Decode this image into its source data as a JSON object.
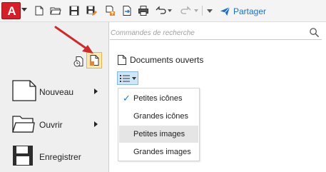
{
  "app": {
    "logo_letter": "A",
    "logo_color": "#d5202a"
  },
  "toolbar": {
    "icons": [
      "new-file-icon",
      "open-folder-icon",
      "save-icon",
      "save-as-icon",
      "save-to-web-icon",
      "open-from-web-icon",
      "print-icon",
      "undo-icon",
      "redo-icon",
      "customize-toolbar-icon"
    ],
    "share_label": "Partager",
    "accent": "#1f6fbf"
  },
  "search": {
    "placeholder": "Commandes de recherche"
  },
  "panel": {
    "title": "Documents ouverts",
    "view_menu": {
      "items": [
        {
          "label": "Petites icônes",
          "checked": true
        },
        {
          "label": "Grandes icônes",
          "checked": false
        },
        {
          "label": "Petites images",
          "checked": false
        },
        {
          "label": "Grandes images",
          "checked": false
        }
      ],
      "check_mark": "✓"
    }
  },
  "commands": [
    {
      "label": "Nouveau",
      "has_submenu": true
    },
    {
      "label": "Ouvrir",
      "has_submenu": true
    },
    {
      "label": "Enregistrer",
      "has_submenu": false
    }
  ],
  "annotation": {
    "arrow_color": "#cc2b2b"
  }
}
